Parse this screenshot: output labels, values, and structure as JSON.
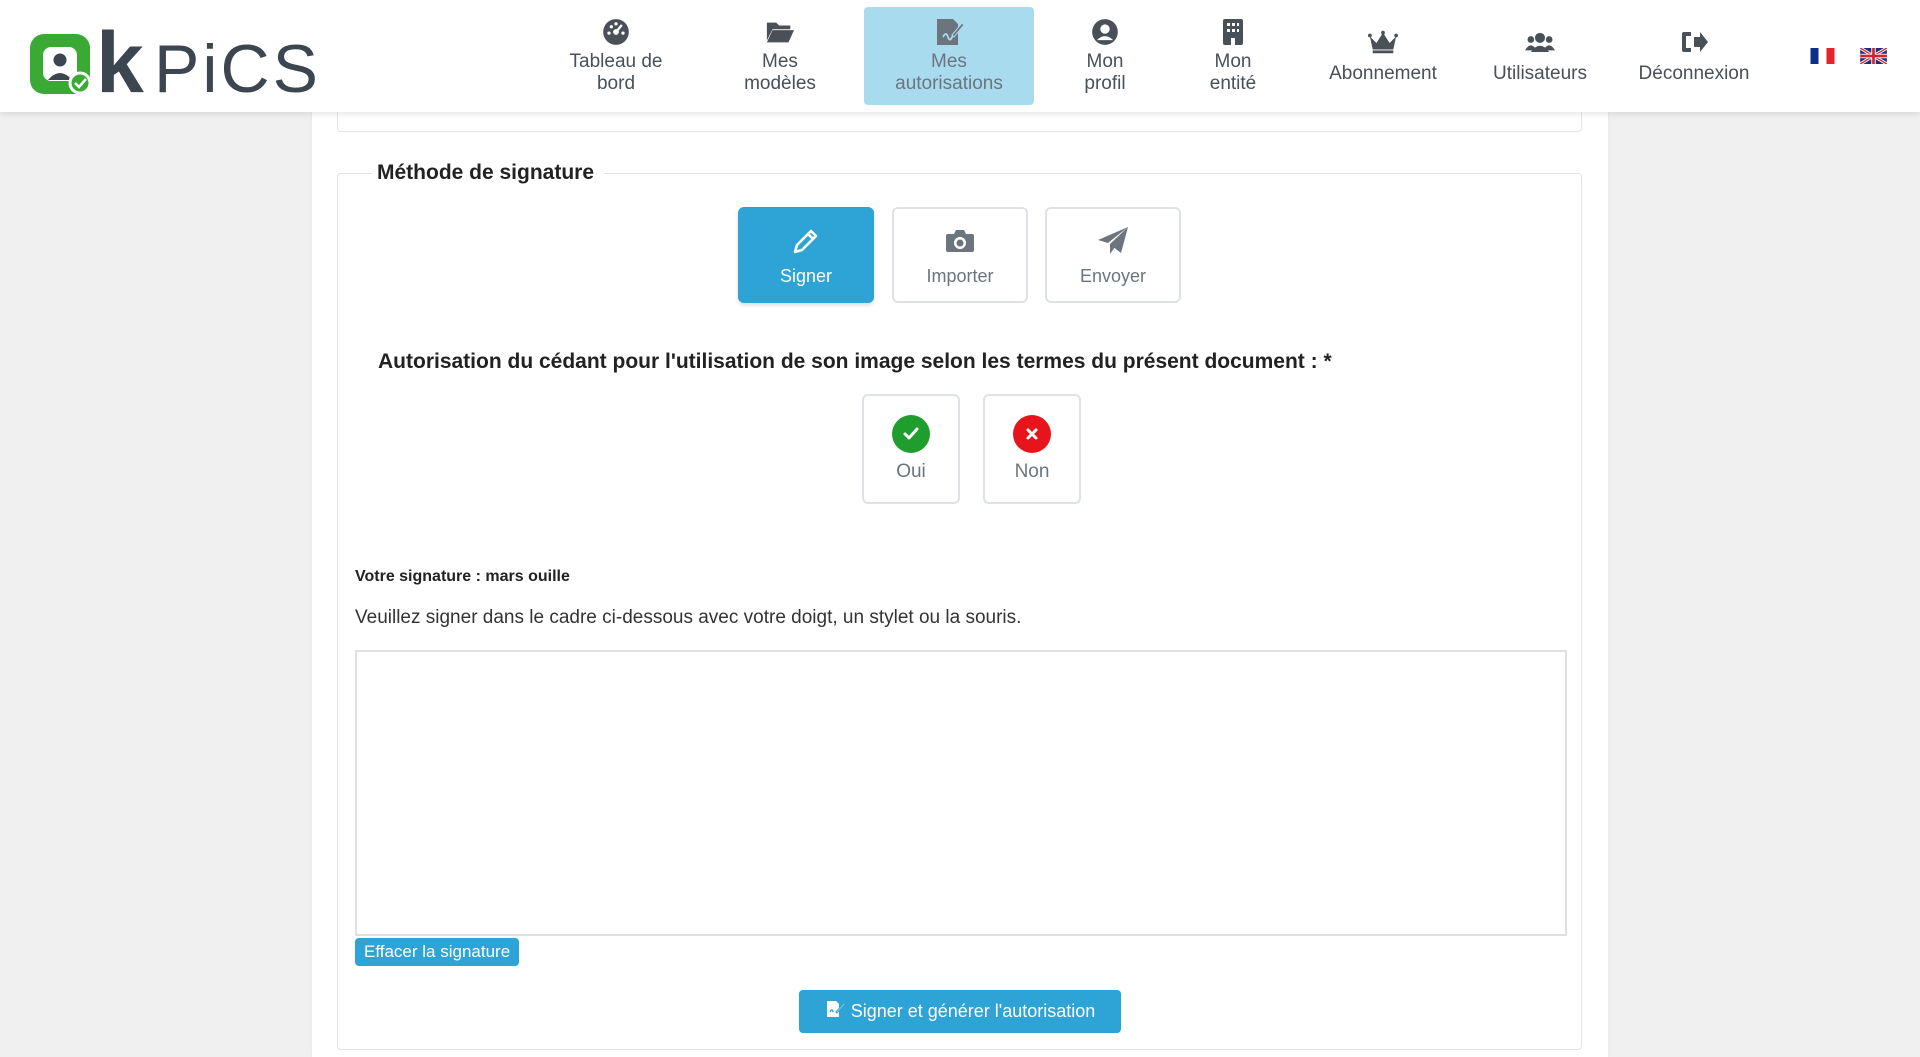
{
  "brand": {
    "logo_text": "kPiCS",
    "colors": {
      "green": "#3aaa35",
      "dark": "#3c4650",
      "accent": "#2ea3d6"
    }
  },
  "nav": {
    "items": [
      {
        "label": "Tableau de\nbord",
        "icon": "dashboard-icon"
      },
      {
        "label": "Mes\nmodèles",
        "icon": "folder-open-icon"
      },
      {
        "label": "Mes\nautorisations",
        "icon": "signature-doc-icon",
        "active": true
      },
      {
        "label": "Mon\nprofil",
        "icon": "user-circle-icon"
      },
      {
        "label": "Mon\nentité",
        "icon": "building-icon"
      },
      {
        "label": "Abonnement",
        "icon": "crown-icon"
      },
      {
        "label": "Utilisateurs",
        "icon": "users-icon"
      },
      {
        "label": "Déconnexion",
        "icon": "sign-out-icon"
      }
    ],
    "languages": [
      "fr-flag-icon",
      "uk-flag-icon"
    ]
  },
  "form": {
    "section_title": "Méthode de signature",
    "methods": [
      {
        "label": "Signer",
        "icon": "pencil-icon",
        "active": true
      },
      {
        "label": "Importer",
        "icon": "camera-icon"
      },
      {
        "label": "Envoyer",
        "icon": "paper-plane-icon"
      }
    ],
    "question": "Autorisation du cédant pour l'utilisation de son image selon les termes du présent document : *",
    "choices": {
      "yes": "Oui",
      "no": "Non"
    },
    "signature_label": "Votre signature : mars ouille",
    "signature_help": "Veuillez signer dans le cadre ci-dessous avec votre doigt, un stylet ou la souris.",
    "clear_label": "Effacer la signature",
    "submit_label": "Signer et générer l'autorisation"
  }
}
